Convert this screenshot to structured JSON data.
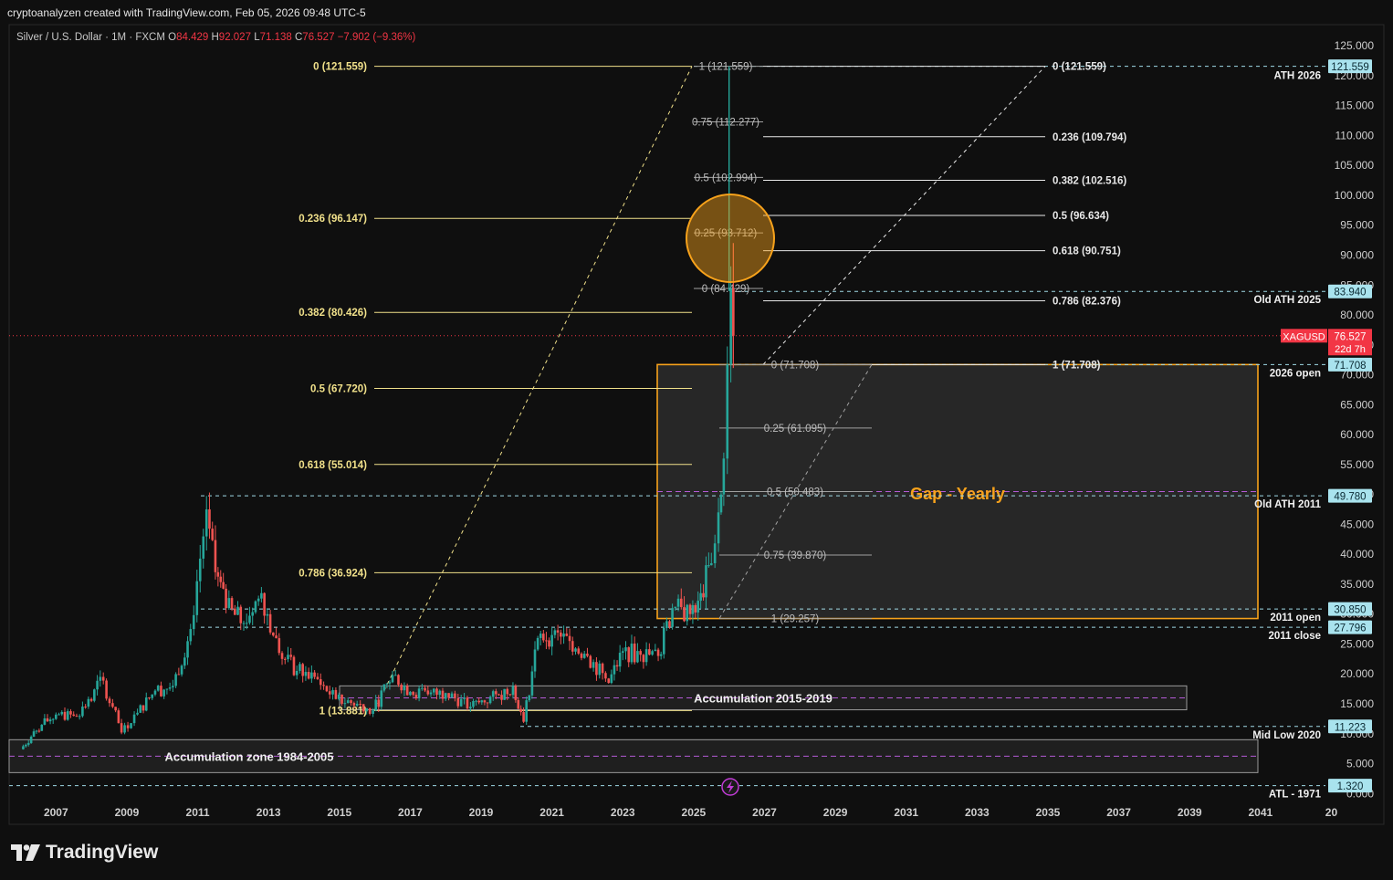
{
  "header": {
    "credit": "cryptoanalyzen created with TradingView.com, Feb 05, 2026 09:48 UTC-5",
    "symbol": "Silver / U.S. Dollar · 1M · FXCM",
    "o_label": "O",
    "o_value": "84.429",
    "h_label": "H",
    "h_value": "92.027",
    "l_label": "L",
    "l_value": "71.138",
    "c_label": "C",
    "c_value": "76.527",
    "change": "−7.902 (−9.36%)"
  },
  "brand": {
    "name": "TradingView",
    "logo_icon": "tradingview-logo-icon"
  },
  "colors": {
    "background": "#0f0f0f",
    "fib_yellow": "#f0e08a",
    "fib_white": "#e8e8e8",
    "fib_gray": "#a0a0a0",
    "dashed_cyan": "#9fd9e6",
    "orange": "#f7a21b",
    "up": "#26a69a",
    "down": "#ef5350",
    "price_red": "#f23645",
    "purple": "#b45ad6"
  },
  "chart_data": {
    "type": "candlestick",
    "x_axis": {
      "ticks": [
        "2007",
        "2009",
        "2011",
        "2013",
        "2015",
        "2017",
        "2019",
        "2021",
        "2023",
        "2025",
        "2027",
        "2029",
        "2031",
        "2033",
        "2035",
        "2037",
        "2039",
        "2041",
        "20"
      ]
    },
    "y_axis": {
      "ticks": [
        "125.000",
        "120.000",
        "115.000",
        "110.000",
        "105.000",
        "100.000",
        "95.000",
        "90.000",
        "85.000",
        "80.000",
        "75.000",
        "70.000",
        "65.000",
        "60.000",
        "55.000",
        "50.000",
        "45.000",
        "40.000",
        "35.000",
        "30.000",
        "25.000",
        "20.000",
        "15.000",
        "10.000",
        "5.000",
        "0.000"
      ],
      "range": [
        0,
        125
      ]
    },
    "price_tags": [
      {
        "label": "121.559",
        "value": 121.559,
        "style": "cyan"
      },
      {
        "label": "83.940",
        "value": 83.94,
        "style": "cyan"
      },
      {
        "label": "XAGUSD",
        "value": 76.527,
        "style": "red-name"
      },
      {
        "label": "76.527",
        "value": 76.527,
        "style": "red"
      },
      {
        "label": "22d 7h",
        "value": 76.527,
        "style": "red-sub"
      },
      {
        "label": "71.708",
        "value": 71.708,
        "style": "cyan"
      },
      {
        "label": "49.780",
        "value": 49.78,
        "style": "cyan"
      },
      {
        "label": "30.850",
        "value": 30.85,
        "style": "cyan"
      },
      {
        "label": "27.796",
        "value": 27.796,
        "style": "cyan"
      },
      {
        "label": "11.223",
        "value": 11.223,
        "style": "cyan"
      },
      {
        "label": "1.320",
        "value": 1.32,
        "style": "cyan"
      }
    ],
    "level_annotations": [
      {
        "label": "ATH 2026",
        "value": 121.559
      },
      {
        "label": "Old ATH 2025",
        "value": 83.94
      },
      {
        "label": "2026 open",
        "value": 71.708
      },
      {
        "label": "Old ATH 2011",
        "value": 49.78
      },
      {
        "label": "2011 open",
        "value": 30.85
      },
      {
        "label": "2011 close",
        "value": 27.796
      },
      {
        "label": "Mid Low 2020",
        "value": 11.223
      },
      {
        "label": "ATL - 1971",
        "value": 1.32
      }
    ],
    "fib_left": [
      {
        "label": "0 (121.559)",
        "value": 121.559
      },
      {
        "label": "0.236 (96.147)",
        "value": 96.147
      },
      {
        "label": "0.382 (80.426)",
        "value": 80.426
      },
      {
        "label": "0.5 (67.720)",
        "value": 67.72
      },
      {
        "label": "0.618 (55.014)",
        "value": 55.014
      },
      {
        "label": "0.786 (36.924)",
        "value": 36.924
      },
      {
        "label": "1 (13.881)",
        "value": 13.881
      }
    ],
    "fib_right": [
      {
        "label": "0 (121.559)",
        "value": 121.559
      },
      {
        "label": "0.236 (109.794)",
        "value": 109.794
      },
      {
        "label": "0.382 (102.516)",
        "value": 102.516
      },
      {
        "label": "0.5 (96.634)",
        "value": 96.634
      },
      {
        "label": "0.618 (90.751)",
        "value": 90.751
      },
      {
        "label": "0.786 (82.376)",
        "value": 82.376
      },
      {
        "label": "1 (71.708)",
        "value": 71.708
      }
    ],
    "fib_mid_upper": [
      {
        "label": "1 (121.559)",
        "value": 121.559
      },
      {
        "label": "0.75 (112.277)",
        "value": 112.277
      },
      {
        "label": "0.5 (102.994)",
        "value": 102.994
      },
      {
        "label": "0.25 (93.712)",
        "value": 93.712
      },
      {
        "label": "0 (84.429)",
        "value": 84.429
      }
    ],
    "fib_mid_lower": [
      {
        "label": "0 (71.708)",
        "value": 71.708
      },
      {
        "label": "0.25 (61.095)",
        "value": 61.095
      },
      {
        "label": "0.5 (50.483)",
        "value": 50.483
      },
      {
        "label": "0.75 (39.870)",
        "value": 39.87
      },
      {
        "label": "1 (29.257)",
        "value": 29.257
      }
    ],
    "zones": [
      {
        "label": "Gap - Yearly",
        "top": 71.708,
        "bottom": 29.257
      },
      {
        "label": "Accumulation 2015-2019",
        "top": 18.0,
        "bottom": 14.0
      },
      {
        "label": "Accumulation zone 1984-2005",
        "top": 9.0,
        "bottom": 3.5
      }
    ],
    "price_series": [
      {
        "year": 2006.0,
        "close": 7.4
      },
      {
        "year": 2006.3,
        "close": 9.5
      },
      {
        "year": 2006.6,
        "close": 11.5
      },
      {
        "year": 2007.0,
        "close": 13.2
      },
      {
        "year": 2007.5,
        "close": 13.0
      },
      {
        "year": 2008.0,
        "close": 15.5
      },
      {
        "year": 2008.25,
        "close": 19.5
      },
      {
        "year": 2008.6,
        "close": 14.5
      },
      {
        "year": 2008.85,
        "close": 10.2
      },
      {
        "year": 2009.3,
        "close": 13.5
      },
      {
        "year": 2009.8,
        "close": 17.2
      },
      {
        "year": 2010.3,
        "close": 18.0
      },
      {
        "year": 2010.8,
        "close": 27.5
      },
      {
        "year": 2011.25,
        "close": 47.5
      },
      {
        "year": 2011.5,
        "close": 37.0
      },
      {
        "year": 2011.8,
        "close": 31.0
      },
      {
        "year": 2012.3,
        "close": 28.5
      },
      {
        "year": 2012.8,
        "close": 33.5
      },
      {
        "year": 2013.3,
        "close": 23.5
      },
      {
        "year": 2013.8,
        "close": 20.5
      },
      {
        "year": 2014.3,
        "close": 19.5
      },
      {
        "year": 2014.9,
        "close": 15.8
      },
      {
        "year": 2015.5,
        "close": 15.0
      },
      {
        "year": 2015.95,
        "close": 13.9
      },
      {
        "year": 2016.5,
        "close": 19.8
      },
      {
        "year": 2017.0,
        "close": 17.0
      },
      {
        "year": 2017.5,
        "close": 16.6
      },
      {
        "year": 2018.0,
        "close": 16.8
      },
      {
        "year": 2018.7,
        "close": 14.5
      },
      {
        "year": 2019.5,
        "close": 16.5
      },
      {
        "year": 2019.9,
        "close": 18.0
      },
      {
        "year": 2020.2,
        "close": 12.0
      },
      {
        "year": 2020.6,
        "close": 26.0
      },
      {
        "year": 2021.0,
        "close": 26.5
      },
      {
        "year": 2021.5,
        "close": 25.5
      },
      {
        "year": 2022.0,
        "close": 23.0
      },
      {
        "year": 2022.6,
        "close": 18.5
      },
      {
        "year": 2023.0,
        "close": 23.8
      },
      {
        "year": 2023.5,
        "close": 23.2
      },
      {
        "year": 2024.0,
        "close": 23.0
      },
      {
        "year": 2024.4,
        "close": 31.0
      },
      {
        "year": 2024.9,
        "close": 30.0
      },
      {
        "year": 2025.2,
        "close": 33.5
      },
      {
        "year": 2025.5,
        "close": 38.5
      },
      {
        "year": 2025.7,
        "close": 47.0
      },
      {
        "year": 2025.85,
        "close": 56.0
      },
      {
        "year": 2025.95,
        "close": 71.7
      },
      {
        "year": 2026.05,
        "close": 84.4
      },
      {
        "year": 2026.12,
        "close": 76.527
      }
    ],
    "current_price": 76.527
  }
}
